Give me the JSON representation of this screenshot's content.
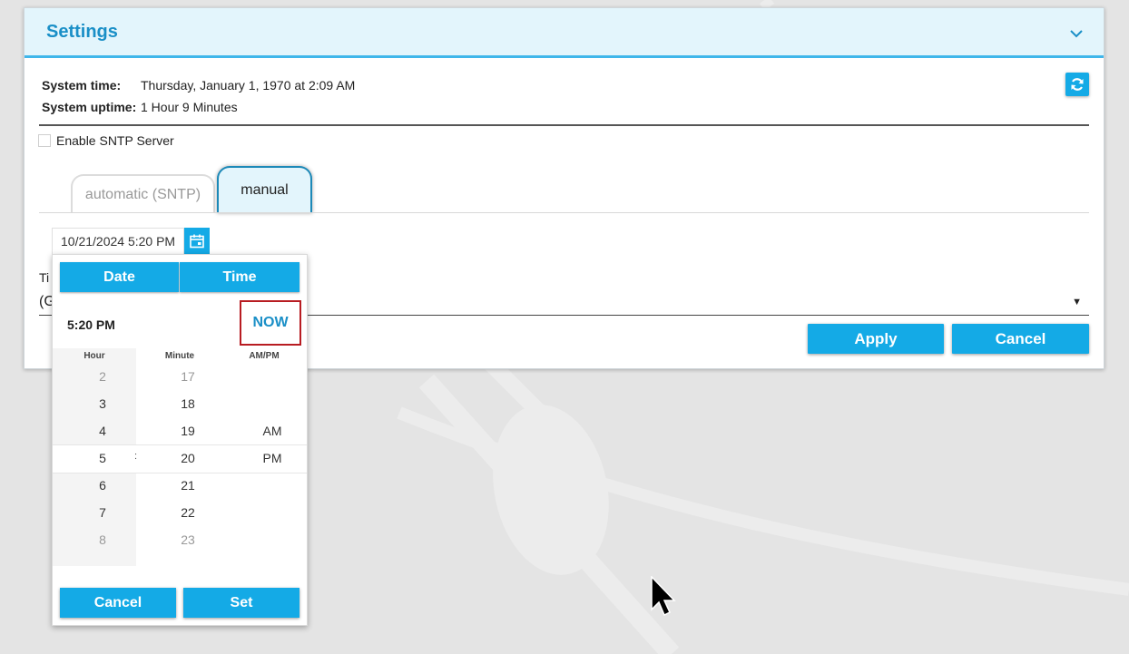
{
  "header": {
    "title": "Settings"
  },
  "system": {
    "time_label": "System time:",
    "time_value": "Thursday, January 1, 1970 at 2:09 AM",
    "uptime_label": "System uptime:",
    "uptime_value": "1 Hour 9 Minutes"
  },
  "sntp": {
    "checkbox_label": "Enable SNTP Server",
    "checked": false
  },
  "tabs": [
    {
      "label": "automatic (SNTP)",
      "active": false
    },
    {
      "label": "manual",
      "active": true
    }
  ],
  "datetime_input": {
    "value": "10/21/2024 5:20 PM"
  },
  "timezone": {
    "label_visible": "Ti",
    "value_visible": "(G"
  },
  "actions": {
    "apply": "Apply",
    "cancel": "Cancel"
  },
  "picker": {
    "tab_date": "Date",
    "tab_time": "Time",
    "current_time": "5:20 PM",
    "now_label": "NOW",
    "col_hour": "Hour",
    "col_minute": "Minute",
    "col_ampm": "AM/PM",
    "hours": [
      "2",
      "3",
      "4",
      "5",
      "6",
      "7",
      "8"
    ],
    "minutes": [
      "17",
      "18",
      "19",
      "20",
      "21",
      "22",
      "23"
    ],
    "am": "AM",
    "pm": "PM",
    "cancel": "Cancel",
    "set": "Set"
  },
  "colors": {
    "accent": "#14aae6",
    "title": "#1a8fc7",
    "highlight_border": "#b81c22"
  }
}
